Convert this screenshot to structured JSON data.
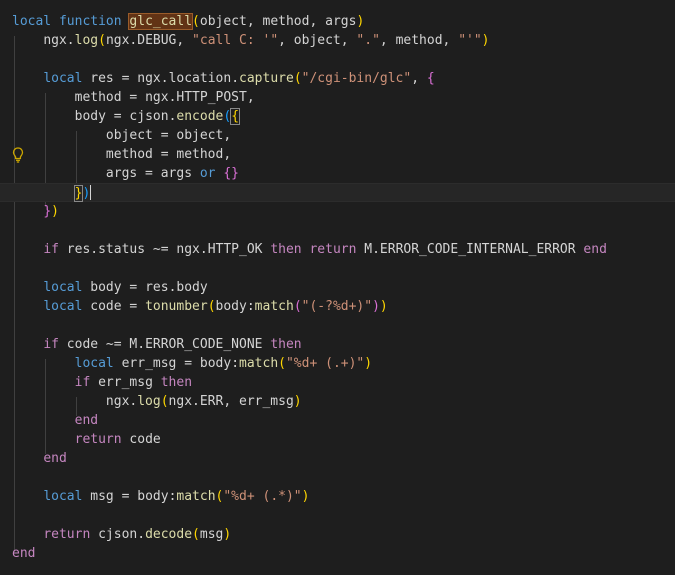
{
  "editor": {
    "language": "lua",
    "cursor_line": 9,
    "lines": [
      "local function glc_call(object, method, args)",
      "    ngx.log(ngx.DEBUG, \"call C: '\", object, \".\", method, \"'\")",
      "",
      "    local res = ngx.location.capture(\"/cgi-bin/glc\", {",
      "        method = ngx.HTTP_POST,",
      "        body = cjson.encode({",
      "            object = object,",
      "            method = method,",
      "            args = args or {}",
      "        })",
      "    })",
      "",
      "    if res.status ~= ngx.HTTP_OK then return M.ERROR_CODE_INTERNAL_ERROR end",
      "",
      "    local body = res.body",
      "    local code = tonumber(body:match(\"(-?%d+)\"))",
      "",
      "    if code ~= M.ERROR_CODE_NONE then",
      "        local err_msg = body:match(\"%d+ (.+)\")",
      "        if err_msg then",
      "            ngx.log(ngx.ERR, err_msg)",
      "        end",
      "        return code",
      "    end",
      "",
      "    local msg = body:match(\"%d+ (.*)\")",
      "",
      "    return cjson.decode(msg)",
      "end"
    ]
  },
  "gutter": {
    "lightbulb_icon": "lightbulb-icon",
    "lightbulb_color": "#cca700"
  },
  "colors": {
    "background": "#1e1e1e",
    "keyword": "#569cd6",
    "control": "#c586c0",
    "function": "#dcdcaa",
    "string": "#ce9178",
    "text": "#d4d4d4",
    "bracket_1": "#ffd700",
    "bracket_2": "#da70d6",
    "bracket_3": "#179fff",
    "word_highlight": "#623315"
  }
}
